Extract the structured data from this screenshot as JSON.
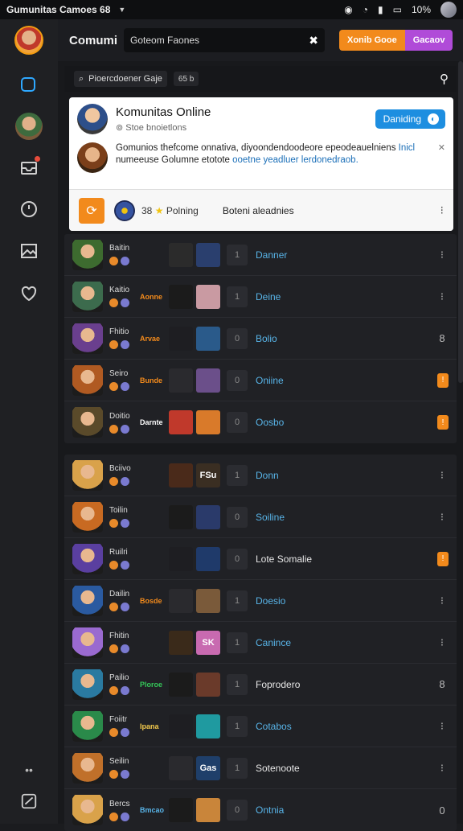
{
  "status_bar": {
    "title": "Gumunitas Camoes 68",
    "battery": "10%"
  },
  "topbar": {
    "title": "Comumi",
    "input_value": "Goteom Faones",
    "btn_orange": "Xonib Gooe",
    "btn_purple": "Gacaov"
  },
  "search": {
    "text": "Pioercdoener Gaje",
    "tag": "65 b"
  },
  "card": {
    "name": "Komunitas Online",
    "subtitle": "Stoe bnoietlons",
    "button": "Daniding",
    "message_plain": "Gomunios thefcome onnativa, diyoondendoodeore epeodeauelniens ",
    "message_link1": "Inicl",
    "message_plain2": " numeeuse Golumne etotote ",
    "message_link2": "ooetne yeadluer lerdonedraob.",
    "footer_count": "38",
    "footer_star": "★",
    "footer_rating": "Polning",
    "footer_label": "Boteni aleadnies"
  },
  "list1": [
    {
      "name": "Baitin",
      "tag": "",
      "tag_color": "#f28a1c",
      "status": "Danner",
      "status_white": false,
      "check": "1",
      "menu": "⁝",
      "menu_orange": false,
      "av": "#3d6b2f",
      "th1": "#2b2b2b",
      "th2": "#2a3f6e",
      "th2_text": ""
    },
    {
      "name": "Kaitio",
      "tag": "Aonne",
      "tag_color": "#f28a1c",
      "status": "Deine",
      "status_white": false,
      "check": "1",
      "menu": "⁝",
      "menu_orange": false,
      "av": "#3c6b4d",
      "th1": "#1b1b1b",
      "th2": "#c99aa2",
      "th2_text": ""
    },
    {
      "name": "Fhitio",
      "tag": "Arvae",
      "tag_color": "#f28a1c",
      "status": "Bolio",
      "status_white": false,
      "check": "0",
      "menu": "8",
      "menu_orange": false,
      "av": "#6a3f8e",
      "th1": "#1e1e22",
      "th2": "#2a5a8a",
      "th2_text": ""
    },
    {
      "name": "Seiro",
      "tag": "Bunde",
      "tag_color": "#f28a1c",
      "status": "Oniine",
      "status_white": false,
      "check": "0",
      "menu": "!",
      "menu_orange": true,
      "av": "#b05a22",
      "th1": "#2a2a2e",
      "th2": "#6b4f8a",
      "th2_text": ""
    },
    {
      "name": "Doitio",
      "tag": "Darnte",
      "tag_color": "#ffffff",
      "status": "Oosbo",
      "status_white": false,
      "check": "0",
      "menu": "!",
      "menu_orange": true,
      "av": "#5a4a2a",
      "th1": "#c0392b",
      "th2": "#d97a2a",
      "th2_text": ""
    }
  ],
  "list2": [
    {
      "name": "Bciivo",
      "tag": "",
      "tag_color": "#f28a1c",
      "status": "Donn",
      "status_white": false,
      "check": "1",
      "menu": "⁝",
      "menu_orange": false,
      "av": "#d9a24a",
      "th1": "#4a2a1a",
      "th2": "#3a2e22",
      "th2_text": "FSu"
    },
    {
      "name": "Toilin",
      "tag": "",
      "tag_color": "#f28a1c",
      "status": "Soiline",
      "status_white": false,
      "check": "0",
      "menu": "⁝",
      "menu_orange": false,
      "av": "#c86a22",
      "th1": "#1b1b1b",
      "th2": "#2a3a6a",
      "th2_text": ""
    },
    {
      "name": "Ruilri",
      "tag": "",
      "tag_color": "#f28a1c",
      "status": "Lote Somalie",
      "status_white": true,
      "check": "0",
      "menu": "!",
      "menu_orange": true,
      "av": "#5a3fa0",
      "th1": "#1e1e22",
      "th2": "#1f3a6a",
      "th2_text": ""
    },
    {
      "name": "Dailin",
      "tag": "Bosde",
      "tag_color": "#f28a1c",
      "status": "Doesio",
      "status_white": false,
      "check": "1",
      "menu": "⁝",
      "menu_orange": false,
      "av": "#2a5aa0",
      "th1": "#2a2a2e",
      "th2": "#7a5a3a",
      "th2_text": ""
    },
    {
      "name": "Fhitin",
      "tag": "",
      "tag_color": "#f28a1c",
      "status": "Canince",
      "status_white": false,
      "check": "1",
      "menu": "⁝",
      "menu_orange": false,
      "av": "#9a6ad0",
      "th1": "#3a2a1a",
      "th2": "#c86ab0",
      "th2_text": "SK"
    },
    {
      "name": "Pailio",
      "tag": "Ploroe",
      "tag_color": "#34c759",
      "status": "Foprodero",
      "status_white": true,
      "check": "1",
      "menu": "8",
      "menu_orange": false,
      "av": "#2a7aa0",
      "th1": "#1b1b1b",
      "th2": "#6a3a2a",
      "th2_text": ""
    },
    {
      "name": "Foiitr",
      "tag": "Ipana",
      "tag_color": "#f2c94c",
      "status": "Cotabos",
      "status_white": false,
      "check": "1",
      "menu": "⁝",
      "menu_orange": false,
      "av": "#2a8a4a",
      "th1": "#1e1e22",
      "th2": "#1f9aa0",
      "th2_text": ""
    },
    {
      "name": "Seilin",
      "tag": "",
      "tag_color": "#f28a1c",
      "status": "Sotenoote",
      "status_white": true,
      "check": "1",
      "menu": "⁝",
      "menu_orange": false,
      "av": "#c0702a",
      "th1": "#2a2a2e",
      "th2": "#1f3f6a",
      "th2_text": "Gas"
    },
    {
      "name": "Bercs",
      "tag": "Bmcao",
      "tag_color": "#58b4e8",
      "status": "Ontnia",
      "status_white": false,
      "check": "0",
      "menu": "0",
      "menu_orange": false,
      "av": "#d9a24a",
      "th1": "#1b1b1b",
      "th2": "#c9853a",
      "th2_text": ""
    }
  ]
}
